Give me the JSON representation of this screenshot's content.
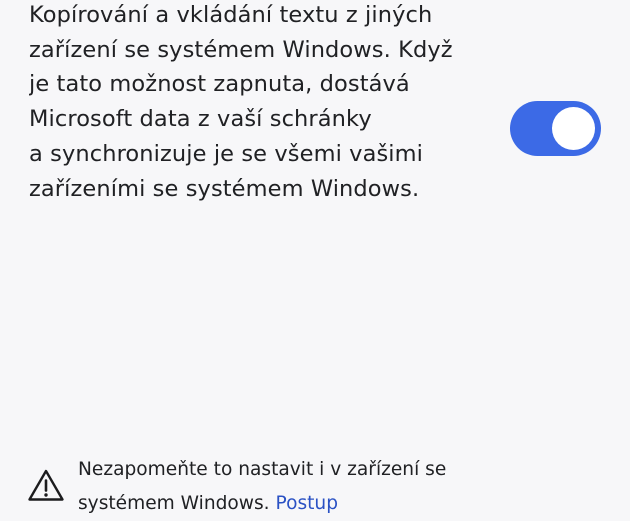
{
  "sync_setting": {
    "description_lines": [
      "Kopírování a vkládání textu z jiných",
      "zařízení se systémem Windows. Když",
      "je tato možnost zapnuta, dostává",
      "Microsoft data z vaší schránky",
      "a synchronizuje je se všemi vašimi",
      "zařízeními se systémem Windows."
    ],
    "toggle_on": true,
    "toggle_color": "#3c6ae6"
  },
  "notice": {
    "icon": "warning-triangle-icon",
    "line1": "Nezapomeňte to nastavit i v zařízení se",
    "line2_prefix": "systémem Windows. ",
    "link_label": "Postup",
    "link_color": "#2a51c4"
  }
}
